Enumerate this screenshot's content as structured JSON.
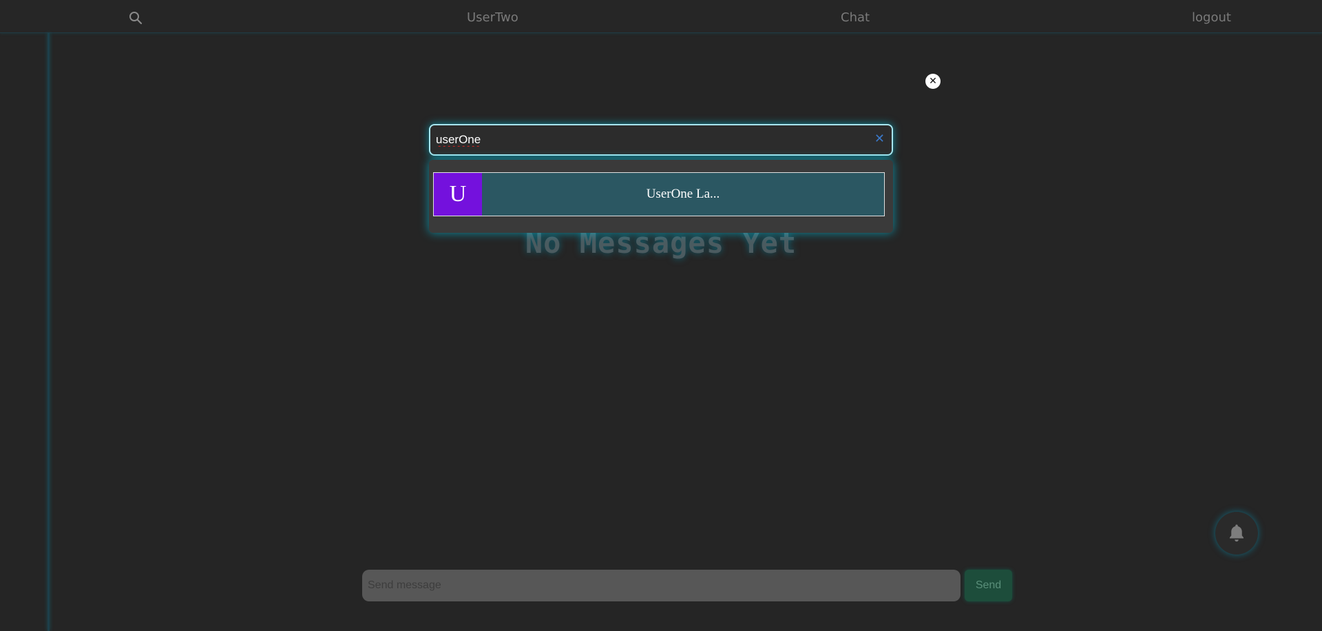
{
  "nav": {
    "search_icon": "search-icon",
    "username": "UserTwo",
    "chat": "Chat",
    "logout": "logout"
  },
  "overlay": {
    "close_icon": "close-icon",
    "search": {
      "value": "userOne",
      "clear_icon": "clear-icon"
    },
    "results": [
      {
        "avatar_letter": "U",
        "name": "UserOne La..."
      }
    ]
  },
  "main": {
    "empty_state": "No Messages Yet"
  },
  "notifications": {
    "icon": "bell-icon"
  },
  "composer": {
    "placeholder": "Send message",
    "send_label": "Send"
  },
  "colors": {
    "background": "#252525",
    "accent_glow": "#00c8e6",
    "avatar": "#7411dd",
    "result_bg": "#2b5762",
    "send_bg": "#1d4d3b"
  }
}
